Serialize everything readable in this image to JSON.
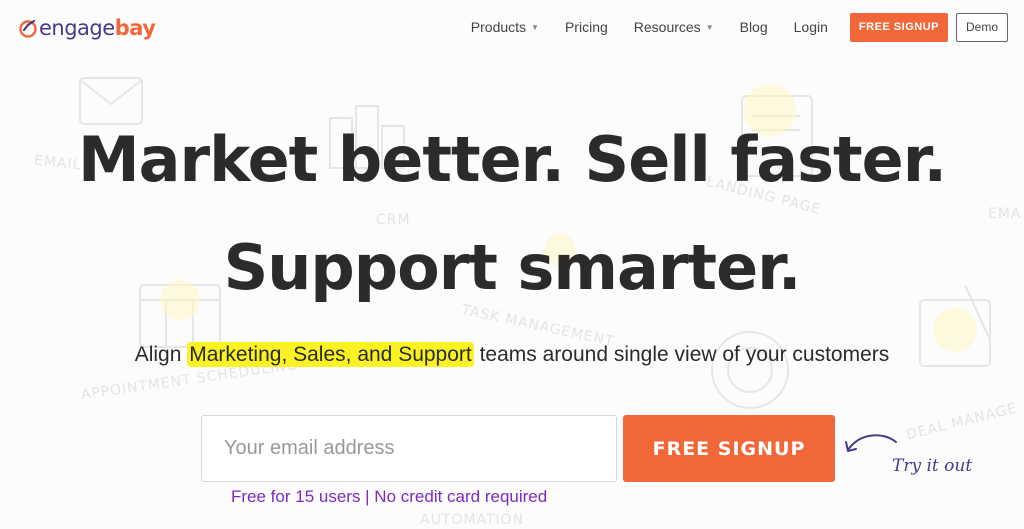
{
  "brand": {
    "name_part_1": "engage",
    "name_part_2": "bay",
    "colors": {
      "orange": "#f2673a",
      "purple": "#4a3a8a"
    }
  },
  "nav": {
    "products": "Products",
    "pricing": "Pricing",
    "resources": "Resources",
    "blog": "Blog",
    "login": "Login",
    "signup": "FREE SIGNUP",
    "demo": "Demo"
  },
  "hero": {
    "line_1": "Market better. Sell faster.",
    "line_2": "Support smarter.",
    "subtitle_prefix": "Align ",
    "subtitle_highlight": "Marketing, Sales, and Support",
    "subtitle_suffix": " teams around single view of your customers"
  },
  "form": {
    "email_placeholder": "Your email address",
    "signup_label": "FREE SIGNUP",
    "note": "Free for 15 users | No credit card required"
  },
  "callout": {
    "text": "Try it out"
  },
  "background_doodles": {
    "email": "EMAIL",
    "crm": "CRM",
    "landing_page": "LANDING PAGE",
    "email_right": "EMA",
    "task_management": "TASK MANAGEMENT",
    "appointment_scheduling": "APPOINTMENT SCHEDULING",
    "deal_management": "DEAL MANAGE",
    "automation": "AUTOMATION"
  }
}
